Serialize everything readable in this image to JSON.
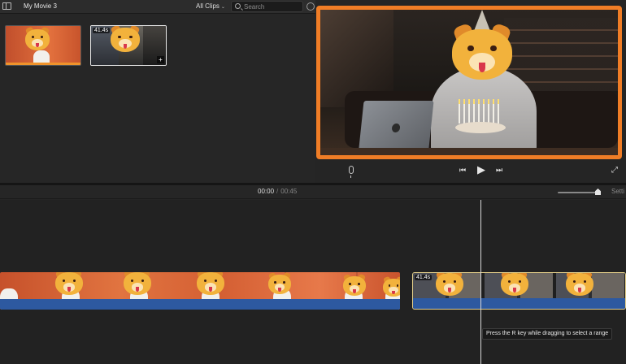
{
  "header": {
    "movie_title": "My Movie 3",
    "clips_filter": "All Clips",
    "search_placeholder": "Search"
  },
  "browser": {
    "clips": [
      {
        "badge": ""
      },
      {
        "badge": "41.4s",
        "add_symbol": "+"
      }
    ]
  },
  "viewer": {
    "selected": true,
    "accent_color": "#f07d26"
  },
  "playback": {
    "skip_back": "⏮",
    "play": "▶",
    "skip_forward": "⏭",
    "fullscreen": "⤢"
  },
  "timeline": {
    "current_time": "00:00",
    "separator": "/",
    "duration": "00:45",
    "settings_label": "Setti",
    "zoom_level": 0.9,
    "clip2_badge": "41.4s",
    "tooltip": "Press the R key while dragging to select a range"
  },
  "icons": [
    "sidebar-toggle-icon",
    "search-icon",
    "settings-icon",
    "microphone-icon",
    "skip-back-icon",
    "play-icon",
    "skip-forward-icon",
    "fullscreen-icon"
  ],
  "colors": {
    "selection_orange": "#f07d26",
    "audio_blue": "#2d59a0",
    "timeline_bg": "#222222"
  }
}
